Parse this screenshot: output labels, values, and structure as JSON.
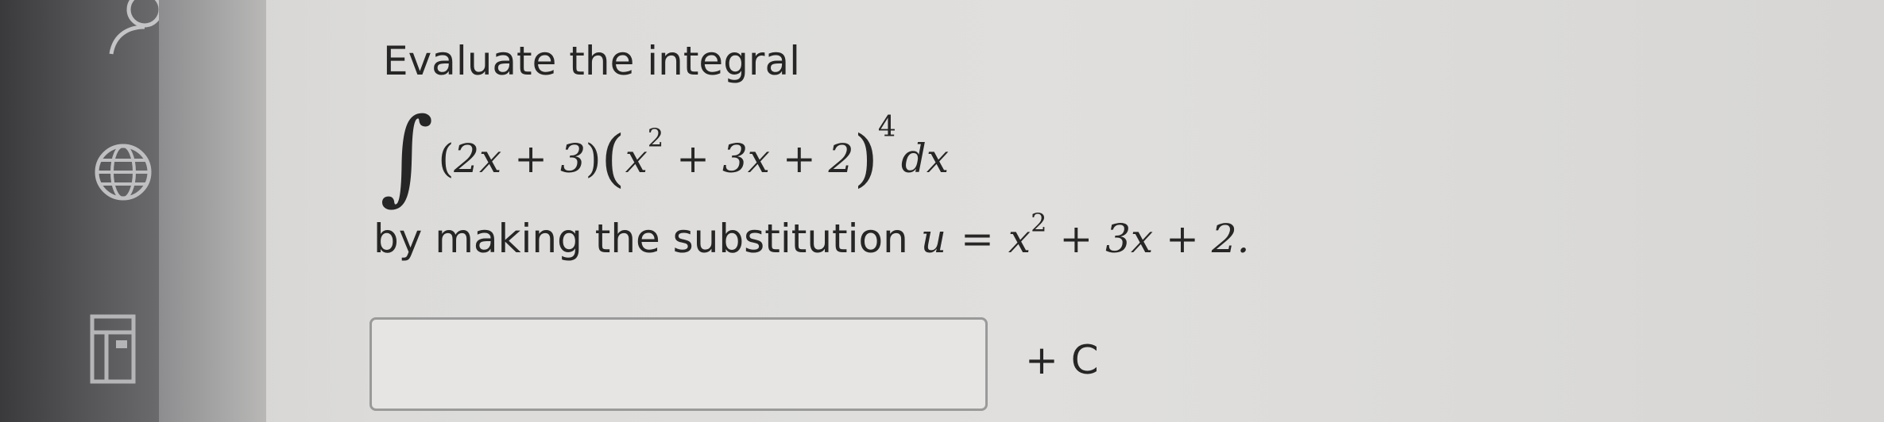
{
  "question": {
    "prompt": "Evaluate the integral",
    "integrand": {
      "integral_sign": "∫",
      "open_paren": "(",
      "factor1": "2x + 3",
      "close_paren": ")",
      "big_open": "(",
      "inner_base": "x",
      "inner_exp": "2",
      "inner_rest": " + 3x + 2",
      "big_close": ")",
      "outer_exp": "4",
      "differential": "dx"
    },
    "substitution_text": "by making the substitution",
    "substitution_lhs": "u",
    "substitution_eq": "=",
    "substitution_base": "x",
    "substitution_exp": "2",
    "substitution_rest": " + 3x + 2."
  },
  "answer": {
    "value": "",
    "suffix": "+ C"
  },
  "icons": [
    "person-icon",
    "globe-icon",
    "table-icon"
  ]
}
